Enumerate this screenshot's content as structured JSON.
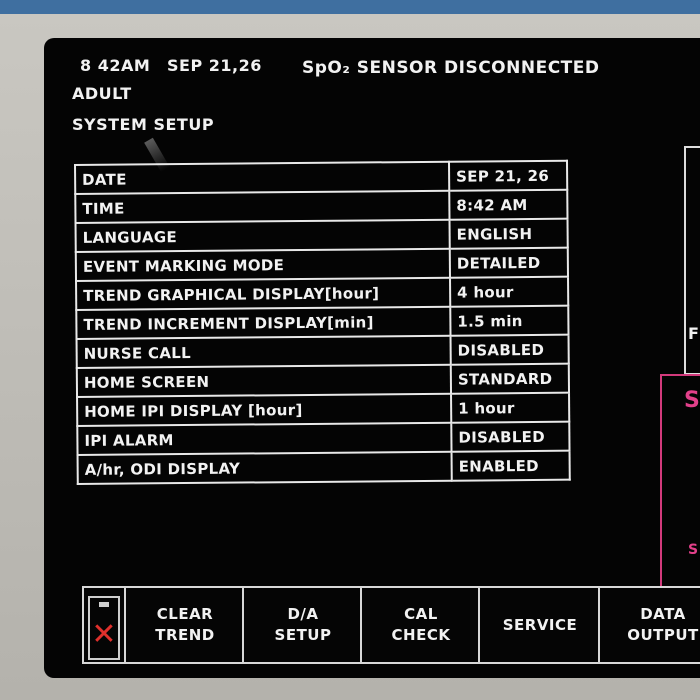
{
  "header": {
    "time": "8 42AM",
    "date": "SEP 21,26",
    "alert": "SpO₂ SENSOR DISCONNECTED",
    "patient_mode": "ADULT",
    "screen_title": "SYSTEM SETUP"
  },
  "settings": [
    {
      "label": "DATE",
      "value": "SEP 21, 26"
    },
    {
      "label": "TIME",
      "value": "8:42 AM"
    },
    {
      "label": "LANGUAGE",
      "value": "ENGLISH"
    },
    {
      "label": "EVENT MARKING MODE",
      "value": "DETAILED"
    },
    {
      "label": "TREND GRAPHICAL DISPLAY[hour]",
      "value": "4 hour"
    },
    {
      "label": "TREND INCREMENT DISPLAY[min]",
      "value": "1.5 min"
    },
    {
      "label": "NURSE CALL",
      "value": "DISABLED"
    },
    {
      "label": "HOME SCREEN",
      "value": "STANDARD"
    },
    {
      "label": "HOME IPI DISPLAY [hour]",
      "value": "1 hour"
    },
    {
      "label": "IPI ALARM",
      "value": "DISABLED"
    },
    {
      "label": "A/hr, ODI DISPLAY",
      "value": "ENABLED"
    }
  ],
  "side_panel": {
    "letter_f": "F",
    "letter_big_s": "S",
    "letter_small_s": "S"
  },
  "softkeys": [
    {
      "label": "CLEAR\nTREND"
    },
    {
      "label": "D/A\nSETUP"
    },
    {
      "label": "CAL\nCHECK"
    },
    {
      "label": "SERVICE"
    },
    {
      "label": "DATA\nOUTPUT"
    }
  ],
  "colors": {
    "screen": "#040404",
    "text": "#f2f2f2",
    "alarm_accent": "#d33a7c",
    "battery_cross": "#e0302c"
  },
  "icons": {
    "battery": "battery-empty-icon"
  }
}
